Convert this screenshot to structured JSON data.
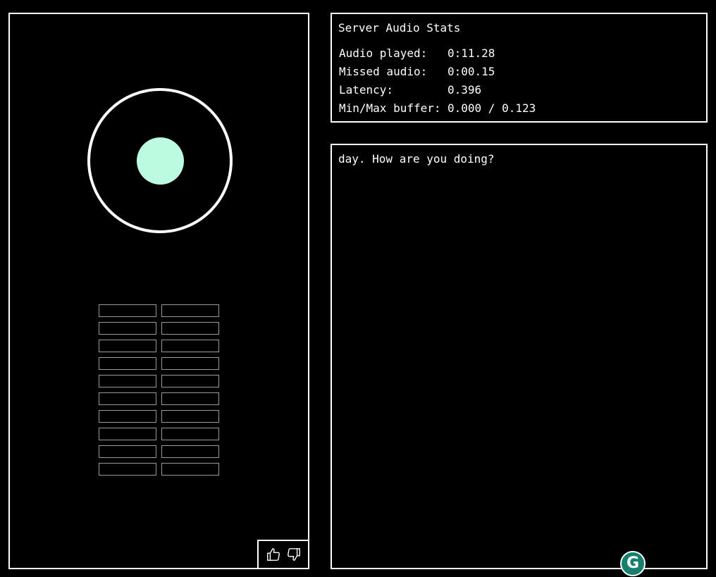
{
  "colors": {
    "background": "#000000",
    "foreground": "#ffffff",
    "visualizer_dot": "#bdfbe0",
    "bar_outline": "#9a9a9a",
    "grammarly_green": "#15806b"
  },
  "visualizer": {
    "ring_icon": "circle-ring",
    "dot_icon": "filled-circle",
    "bar_rows": 10,
    "bar_columns": 2
  },
  "feedback": {
    "thumbs_up_icon": "thumbs-up-icon",
    "thumbs_down_icon": "thumbs-down-icon"
  },
  "stats": {
    "title": "Server Audio Stats",
    "rows": [
      {
        "label": "Audio played:",
        "value": "0:11.28"
      },
      {
        "label": "Missed audio:",
        "value": "0:00.15"
      },
      {
        "label": "Latency:",
        "value": "0.396"
      },
      {
        "label": "Min/Max buffer:",
        "value": "0.000 / 0.123"
      }
    ]
  },
  "transcript": {
    "text": "day. How are you doing?"
  },
  "grammarly": {
    "letter": "G",
    "icon": "grammarly-icon"
  }
}
